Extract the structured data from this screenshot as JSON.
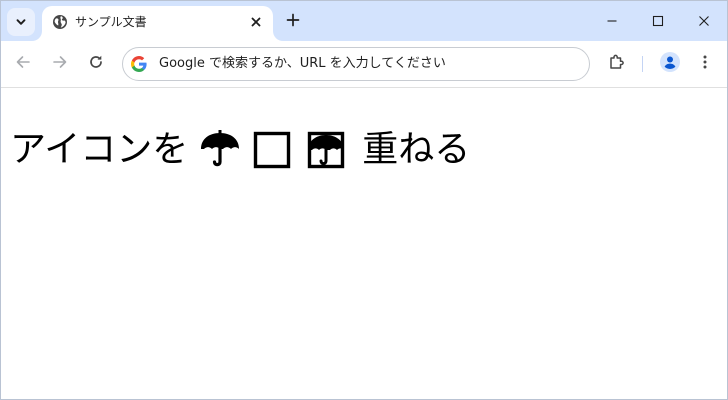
{
  "browser": {
    "tab": {
      "title": "サンプル文書",
      "favicon": "globe-icon"
    },
    "address_bar": {
      "placeholder": "Google で検索するか、URL を入力してください",
      "search_engine_icon": "google-icon"
    },
    "icons": {
      "tab_search": "chevron-down-icon",
      "tab_close": "close-icon",
      "new_tab": "plus-icon",
      "back": "arrow-left-icon",
      "forward": "arrow-right-icon",
      "reload": "reload-icon",
      "extensions": "puzzle-icon",
      "profile": "person-icon",
      "menu": "kebab-menu-icon",
      "minimize": "minimize-icon",
      "maximize": "maximize-icon",
      "close_window": "close-icon"
    },
    "colors": {
      "tabstrip": "#d3e3fd",
      "profile_accent": "#0b57d0"
    }
  },
  "page": {
    "heading_before": "アイコンを",
    "heading_after": "重ねる",
    "glyphs": [
      "umbrella-icon",
      "square-outline-icon",
      "overlaid-umbrella-square-icon"
    ]
  }
}
